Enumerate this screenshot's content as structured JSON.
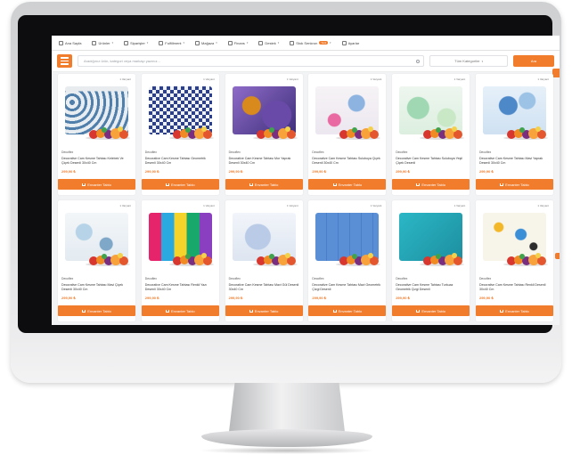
{
  "nav": {
    "items": [
      {
        "label": "Ana Sayfa",
        "icon": "home-icon"
      },
      {
        "label": "Ürünler",
        "icon": "box-icon"
      },
      {
        "label": "Siparişler",
        "icon": "list-icon"
      },
      {
        "label": "Fulfillment",
        "icon": "truck-icon"
      },
      {
        "label": "Mağaza",
        "icon": "store-icon"
      },
      {
        "label": "Finans",
        "icon": "wallet-icon"
      },
      {
        "label": "Destek",
        "icon": "support-icon"
      },
      {
        "label": "Stok Senkron",
        "icon": "sync-icon",
        "badge": "Yeni"
      },
      {
        "label": "Ayarlar",
        "icon": "gear-icon"
      }
    ]
  },
  "search": {
    "placeholder": "Aradığınız ürün, kategori veya markayı yazınız...",
    "category_label": "Tüm Kategoriler",
    "button_label": "Ara"
  },
  "products": [
    {
      "badge": "1 Varyant",
      "brand": "Decoflex",
      "title": "Decorative Cam Kesme Tahtası Kelebek Ve Çiçek Desenli 30x40 Cm",
      "price": "299,90 ₺",
      "button": "Envanter Tablo"
    },
    {
      "badge": "1 Varyant",
      "brand": "Decoflex",
      "title": "Decorative Cam Kesme Tahtası Geometrik Desenli 30x40 Cm",
      "price": "299,90 ₺",
      "button": "Envanter Tablo"
    },
    {
      "badge": "1 Varyant",
      "brand": "Decoflex",
      "title": "Decorative Cam Kesme Tahtası Mor Yaprak Desenli 30x40 Cm",
      "price": "299,90 ₺",
      "button": "Envanter Tablo"
    },
    {
      "badge": "1 Varyant",
      "brand": "Decoflex",
      "title": "Decorative Cam Kesme Tahtası Suluboya Çiçek Desenli 30x40 Cm",
      "price": "299,90 ₺",
      "button": "Envanter Tablo"
    },
    {
      "badge": "1 Varyant",
      "brand": "Decoflex",
      "title": "Decorative Cam Kesme Tahtası Suluboya Yeşil Çiçek Desenli",
      "price": "299,90 ₺",
      "button": "Envanter Tablo"
    },
    {
      "badge": "1 Varyant",
      "brand": "Decoflex",
      "title": "Decorative Cam Kesme Tahtası Mavi Yaprak Desenli 30x40 Cm",
      "price": "299,90 ₺",
      "button": "Envanter Tablo"
    },
    {
      "badge": "1 Varyant",
      "brand": "Decoflex",
      "title": "Decorative Cam Kesme Tahtası Mavi Çiçek Desenli 30x40 Cm",
      "price": "299,90 ₺",
      "button": "Envanter Tablo"
    },
    {
      "badge": "1 Varyant",
      "brand": "Decoflex",
      "title": "Decorative Cam Kesme Tahtası Renkli Yazı Desenli 30x40 Cm",
      "price": "299,90 ₺",
      "button": "Envanter Tablo"
    },
    {
      "badge": "1 Varyant",
      "brand": "Decoflex",
      "title": "Decorative Cam Kesme Tahtası Mavi Gül Desenli 30x40 Cm",
      "price": "299,90 ₺",
      "button": "Envanter Tablo"
    },
    {
      "badge": "1 Varyant",
      "brand": "Decoflex",
      "title": "Decorative Cam Kesme Tahtası Mavi Geometrik Çizgi Desenli",
      "price": "299,90 ₺",
      "button": "Envanter Tablo"
    },
    {
      "badge": "1 Varyant",
      "brand": "Decoflex",
      "title": "Decorative Cam Kesme Tahtası Turkuaz Geometrik Çizgi Desenli",
      "price": "299,90 ₺",
      "button": "Envanter Tablo"
    },
    {
      "badge": "1 Varyant",
      "brand": "Decoflex",
      "title": "Decorative Cam Kesme Tahtası Renkli Desenli 30x40 Cm",
      "price": "299,90 ₺",
      "button": "Envanter Tablo"
    }
  ],
  "colors": {
    "accent": "#f07c2c",
    "price": "#f07c2c",
    "screen_bg": "#f2f3f5"
  }
}
